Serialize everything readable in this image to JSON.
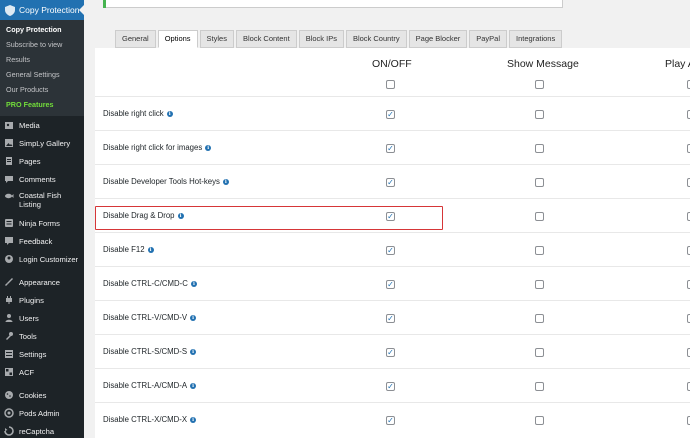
{
  "sidebar": {
    "active": {
      "label": "Copy Protection",
      "icon": "shield-icon"
    },
    "submenu": [
      {
        "label": "Copy Protection",
        "current": true
      },
      {
        "label": "Subscribe to view"
      },
      {
        "label": "Results"
      },
      {
        "label": "General Settings"
      },
      {
        "label": "Our Products"
      },
      {
        "label": "PRO Features",
        "pro": true
      }
    ],
    "items": [
      {
        "label": "Media",
        "icon": "media-icon"
      },
      {
        "label": "SimpLy Gallery",
        "icon": "gallery-icon"
      },
      {
        "label": "Pages",
        "icon": "pages-icon"
      },
      {
        "label": "Comments",
        "icon": "comments-icon"
      },
      {
        "label": "Coastal Fish Listing",
        "icon": "fish-listing-icon"
      },
      {
        "label": "Ninja Forms",
        "icon": "ninja-forms-icon"
      },
      {
        "label": "Feedback",
        "icon": "feedback-icon"
      },
      {
        "label": "Login Customizer",
        "icon": "login-customizer-icon"
      },
      {
        "label": "Appearance",
        "icon": "appearance-icon"
      },
      {
        "label": "Plugins",
        "icon": "plugins-icon"
      },
      {
        "label": "Users",
        "icon": "users-icon"
      },
      {
        "label": "Tools",
        "icon": "tools-icon"
      },
      {
        "label": "Settings",
        "icon": "settings-icon"
      },
      {
        "label": "ACF",
        "icon": "acf-icon"
      },
      {
        "label": "Cookies",
        "icon": "cookies-icon"
      },
      {
        "label": "Pods Admin",
        "icon": "pods-icon"
      },
      {
        "label": "reCaptcha",
        "icon": "recaptcha-icon"
      }
    ]
  },
  "tabs": [
    "General",
    "Options",
    "Styles",
    "Block Content",
    "Block IPs",
    "Block Country",
    "Page Blocker",
    "PayPal",
    "Integrations"
  ],
  "active_tab": "Options",
  "columns": [
    "ON/OFF",
    "Show Message",
    "Play A"
  ],
  "header_checkboxes": [
    false,
    false,
    false
  ],
  "rows": [
    {
      "label": "Disable right click",
      "on": true,
      "show_message": false,
      "play": false
    },
    {
      "label": "Disable right click for images",
      "on": true,
      "show_message": false,
      "play": false
    },
    {
      "label": "Disable Developer Tools Hot-keys",
      "on": true,
      "show_message": false,
      "play": false
    },
    {
      "label": "Disable Drag & Drop",
      "on": true,
      "show_message": false,
      "play": false,
      "highlighted": true
    },
    {
      "label": "Disable F12",
      "on": true,
      "show_message": false,
      "play": false
    },
    {
      "label": "Disable CTRL-C/CMD-C",
      "on": true,
      "show_message": false,
      "play": false
    },
    {
      "label": "Disable CTRL-V/CMD-V",
      "on": true,
      "show_message": false,
      "play": false
    },
    {
      "label": "Disable CTRL-S/CMD-S",
      "on": true,
      "show_message": false,
      "play": false
    },
    {
      "label": "Disable CTRL-A/CMD-A",
      "on": true,
      "show_message": false,
      "play": false
    },
    {
      "label": "Disable CTRL-X/CMD-X",
      "on": true,
      "show_message": false,
      "play": false
    }
  ],
  "colors": {
    "sidebar_bg": "#1d2327",
    "accent": "#2271b1",
    "pro": "#72dd3a",
    "highlight": "#d63638"
  }
}
